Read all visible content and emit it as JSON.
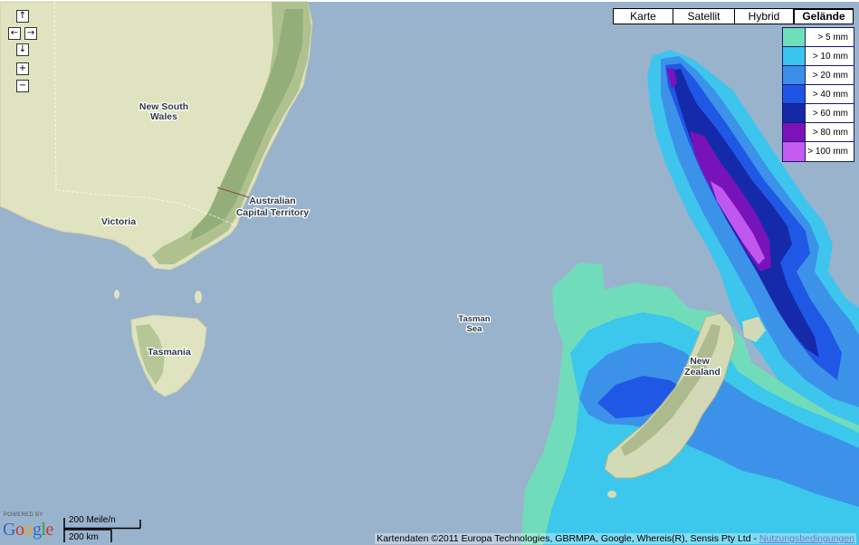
{
  "map_labels": {
    "nsw_line1": "New South",
    "nsw_line2": "Wales",
    "victoria": "Victoria",
    "act_line1": "Australian",
    "act_line2": "Capital Territory",
    "tasmania": "Tasmania",
    "tasman_line1": "Tasman",
    "tasman_line2": "Sea",
    "nz_line1": "New",
    "nz_line2": "Zealand"
  },
  "nav": {
    "pan_up": "↑",
    "pan_left": "←",
    "pan_right": "→",
    "pan_down": "↓",
    "zoom_in": "+",
    "zoom_out": "−"
  },
  "map_types": [
    {
      "label": "Karte",
      "active": false
    },
    {
      "label": "Satellit",
      "active": false
    },
    {
      "label": "Hybrid",
      "active": false
    },
    {
      "label": "Gelände",
      "active": true
    }
  ],
  "legend": [
    {
      "label": "> 5 mm",
      "color": "#6ee0b8"
    },
    {
      "label": "> 10 mm",
      "color": "#39c6ee"
    },
    {
      "label": "> 20 mm",
      "color": "#3c8fe8"
    },
    {
      "label": "> 40 mm",
      "color": "#1f55e6"
    },
    {
      "label": "> 60 mm",
      "color": "#1528a8"
    },
    {
      "label": "> 80 mm",
      "color": "#7c12b8"
    },
    {
      "label": "> 100 mm",
      "color": "#c45cf2"
    }
  ],
  "scale": {
    "imperial": "200 Meile/n",
    "metric": "200 km"
  },
  "logo": {
    "powered_by": "POWERED BY",
    "brand": "Google"
  },
  "attribution": {
    "text": "Kartendaten ©2011 Europa Technologies, GBRMPA, Google, Whereis(R), Sensis Pty Ltd - ",
    "link": "Nutzungsbedingungen"
  }
}
